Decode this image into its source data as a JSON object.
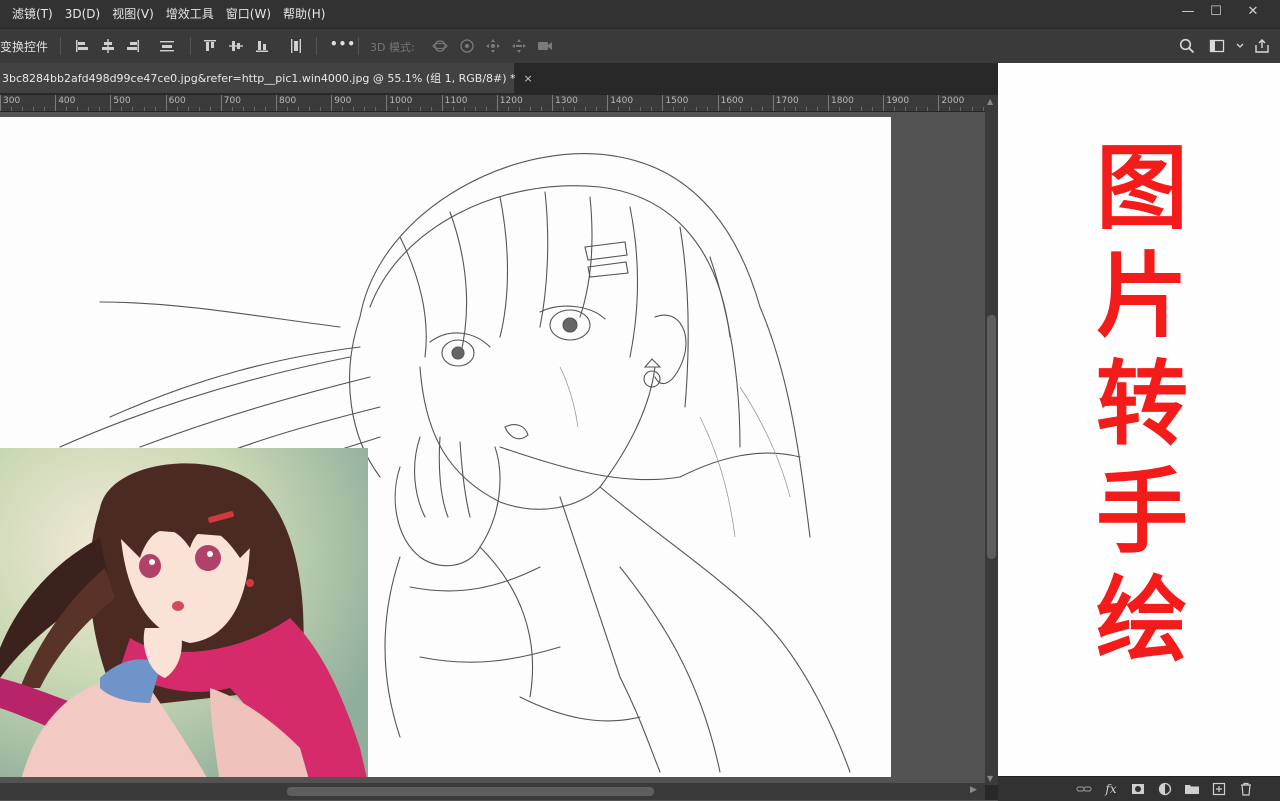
{
  "menu": {
    "items": [
      "滤镜(T)",
      "3D(D)",
      "视图(V)",
      "增效工具",
      "窗口(W)",
      "帮助(H)"
    ]
  },
  "window_controls": {
    "minimize": "—",
    "maximize": "☐",
    "close": "✕"
  },
  "options_bar": {
    "transform_controls_label": "变换控件",
    "more_label": "•••",
    "mode_3d_label": "3D 模式:"
  },
  "document": {
    "tab_title": "3bc8284bb2afd498d99ce47ce0.jpg&refer=http__pic1.win4000.jpg @ 55.1% (组 1, RGB/8#) *",
    "close_symbol": "×"
  },
  "ruler": {
    "labels": [
      "300",
      "400",
      "500",
      "600",
      "700",
      "800",
      "900",
      "1000",
      "1100",
      "1200",
      "1300",
      "1400",
      "1500",
      "1600",
      "1700",
      "1800",
      "1900",
      "2000"
    ]
  },
  "promo": {
    "chars": [
      "图",
      "片",
      "转",
      "手",
      "绘"
    ],
    "color": "#f41b1b"
  },
  "colors": {
    "menubar_bg": "#323232",
    "options_bg": "#3a3a3a",
    "canvas_bg": "#535353"
  }
}
